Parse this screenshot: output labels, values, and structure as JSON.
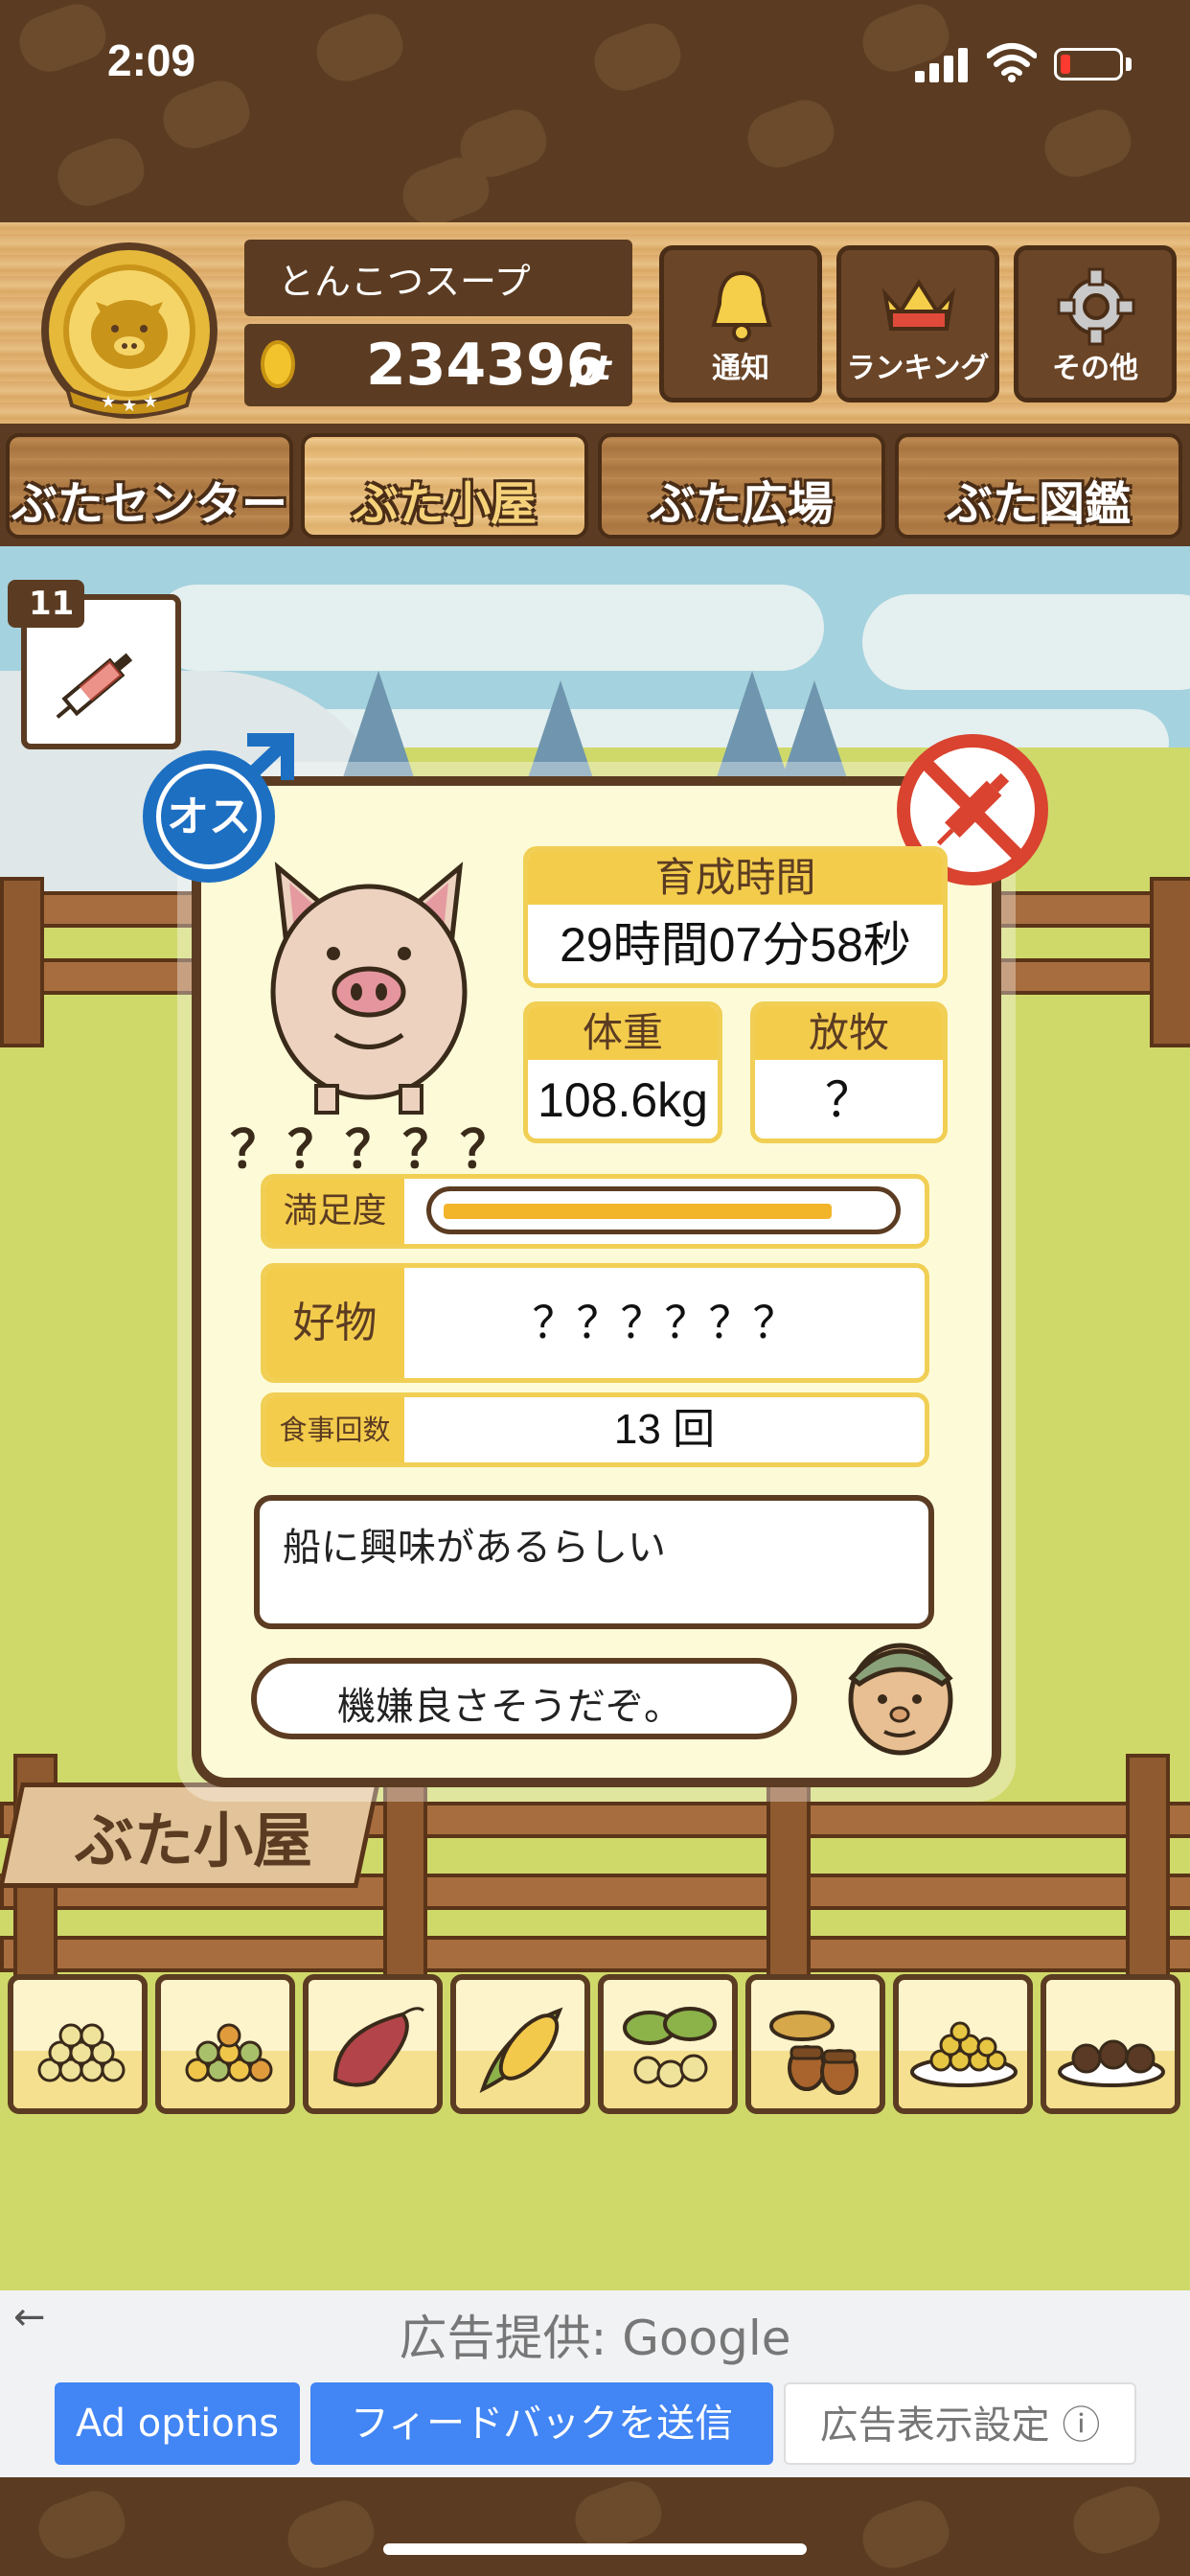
{
  "status_bar": {
    "time": "2:09",
    "icons": [
      "signal-icon",
      "wifi-icon",
      "battery-low-icon"
    ]
  },
  "player": {
    "name": "とんこつスープ",
    "points": "234396",
    "points_unit": "pt"
  },
  "header_buttons": [
    {
      "label": "通知",
      "icon": "bell-icon"
    },
    {
      "label": "ランキング",
      "icon": "crown-icon"
    },
    {
      "label": "その他",
      "icon": "gear-icon"
    }
  ],
  "tabs": [
    {
      "label": "ぶたセンター",
      "active": false
    },
    {
      "label": "ぶた小屋",
      "active": true
    },
    {
      "label": "ぶた広場",
      "active": false
    },
    {
      "label": "ぶた図鑑",
      "active": false
    }
  ],
  "vaccine": {
    "count": "11",
    "icon": "syringe-icon"
  },
  "pig": {
    "gender_label": "オス",
    "name": "？？？？？",
    "growth_time_label": "育成時間",
    "growth_time": "29時間07分58秒",
    "weight_label": "体重",
    "weight": "108.6kg",
    "grazing_label": "放牧",
    "grazing": "？",
    "satisfaction_label": "満足度",
    "satisfaction_level": 0.88,
    "favorite_label": "好物",
    "favorite": "？？？？？？",
    "meal_count_label": "食事回数",
    "meal_count": "13 回",
    "speech_main": "船に興味があるらしい",
    "speech_farmer": "機嫌良さそうだぞ。"
  },
  "sign_label": "ぶた小屋",
  "food_items": [
    "grain-icon",
    "mixed-grain-icon",
    "sweet-potato-icon",
    "corn-icon",
    "soybean-icon",
    "acorn-icon",
    "bean-plate-icon",
    "chocolate-plate-icon"
  ],
  "ad": {
    "back": "←",
    "provider": "広告提供: Google",
    "options_label": "Ad options",
    "feedback_label": "フィードバックを送信",
    "settings_label": "広告表示設定 ⓘ"
  },
  "colors": {
    "wood_dark": "#5b3c22",
    "accent_yellow": "#f4cc4c",
    "ad_blue": "#4285f4",
    "gender_blue": "#1d6fc2",
    "prohibit_red": "#d9432f"
  }
}
